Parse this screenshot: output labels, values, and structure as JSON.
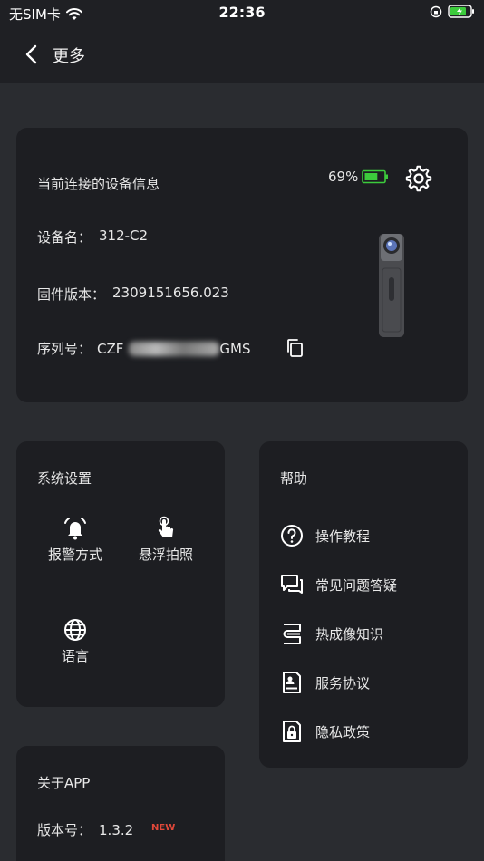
{
  "status_bar": {
    "carrier": "无SIM卡",
    "time": "22:36"
  },
  "nav": {
    "title": "更多"
  },
  "device_info": {
    "title": "当前连接的设备信息",
    "battery_percent": "69%",
    "battery_level": 0.69,
    "name_label": "设备名：",
    "name_value": "312-C2",
    "firmware_label": "固件版本：",
    "firmware_value": "2309151656.023",
    "serial_label": "序列号：",
    "serial_prefix": "CZF",
    "serial_suffix": "GMS"
  },
  "system_settings": {
    "title": "系统设置",
    "items": [
      {
        "label": "报警方式",
        "icon": "alarm-bell-icon"
      },
      {
        "label": "悬浮拍照",
        "icon": "tap-hand-icon"
      },
      {
        "label": "语言",
        "icon": "globe-icon"
      }
    ]
  },
  "help": {
    "title": "帮助",
    "items": [
      {
        "label": "操作教程",
        "icon": "question-circle-icon"
      },
      {
        "label": "常见问题答疑",
        "icon": "chat-icon"
      },
      {
        "label": "热成像知识",
        "icon": "book-icon"
      },
      {
        "label": "服务协议",
        "icon": "document-user-icon"
      },
      {
        "label": "隐私政策",
        "icon": "document-lock-icon"
      }
    ]
  },
  "about": {
    "title": "关于APP",
    "version_label": "版本号：",
    "version_value": "1.3.2",
    "new_badge": "NEW"
  },
  "colors": {
    "background": "#2a2c30",
    "card": "#1d1e22",
    "battery_green": "#3ccb3c",
    "new_red": "#e0483a"
  }
}
